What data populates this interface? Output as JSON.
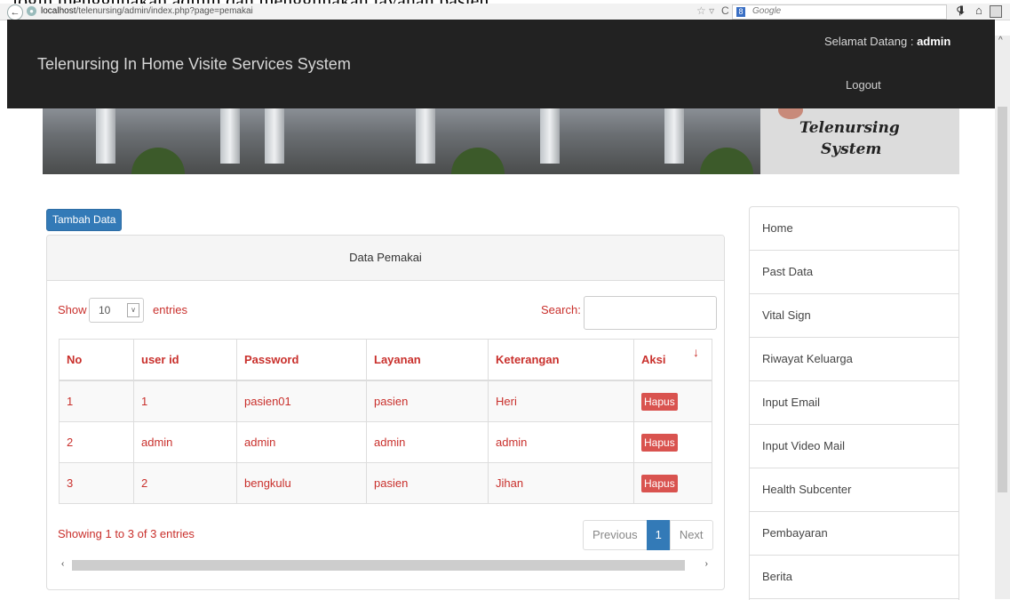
{
  "caption": "login menggunakan admin dan menggunakan layanan pasien.",
  "browser": {
    "url_host": "localhost",
    "url_path": "/telenursing/admin/index.php?page=pemakai",
    "search_engine_badge": "8",
    "search_placeholder": "Google"
  },
  "navbar": {
    "brand": "Telenursing In Home Visite Services System",
    "welcome_prefix": "Selamat Datang : ",
    "username": "admin",
    "logout": "Logout"
  },
  "banner": {
    "logo_line1": "Telenursing",
    "logo_line2": "System"
  },
  "actions": {
    "add_data": "Tambah Data"
  },
  "panel": {
    "title": "Data Pemakai"
  },
  "table_controls": {
    "show": "Show",
    "page_length": "10",
    "entries": "entries",
    "search_label": "Search:",
    "search_value": ""
  },
  "table": {
    "columns": [
      "No",
      "user id",
      "Password",
      "Layanan",
      "Keterangan",
      "Aksi"
    ],
    "rows": [
      {
        "no": "1",
        "user_id": "1",
        "password": "pasien01",
        "layanan": "pasien",
        "keterangan": "Heri",
        "aksi": "Hapus"
      },
      {
        "no": "2",
        "user_id": "admin",
        "password": "admin",
        "layanan": "admin",
        "keterangan": "admin",
        "aksi": "Hapus"
      },
      {
        "no": "3",
        "user_id": "2",
        "password": "bengkulu",
        "layanan": "pasien",
        "keterangan": "Jihan",
        "aksi": "Hapus"
      }
    ]
  },
  "pagination": {
    "info": "Showing 1 to 3 of 3 entries",
    "previous": "Previous",
    "current": "1",
    "next": "Next"
  },
  "sidebar": {
    "items": [
      {
        "label": "Home"
      },
      {
        "label": "Past Data"
      },
      {
        "label": "Vital Sign"
      },
      {
        "label": "Riwayat Keluarga"
      },
      {
        "label": "Input Email"
      },
      {
        "label": "Input Video Mail"
      },
      {
        "label": "Health Subcenter"
      },
      {
        "label": "Pembayaran"
      },
      {
        "label": "Berita"
      }
    ]
  },
  "colors": {
    "navbar": "#222222",
    "primary": "#337ab7",
    "danger": "#d9534f",
    "table_text": "#c9302c"
  }
}
